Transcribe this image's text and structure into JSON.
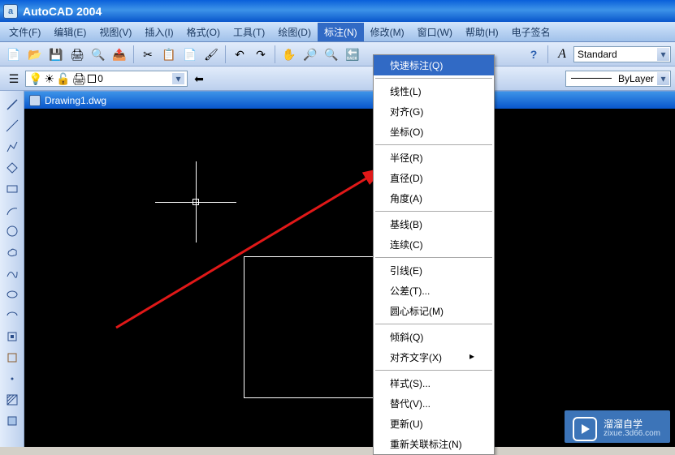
{
  "app": {
    "title": "AutoCAD 2004"
  },
  "menu": {
    "file": "文件(F)",
    "edit": "编辑(E)",
    "view": "视图(V)",
    "insert": "插入(I)",
    "format": "格式(O)",
    "tools": "工具(T)",
    "draw": "绘图(D)",
    "dimension": "标注(N)",
    "modify": "修改(M)",
    "window": "窗口(W)",
    "help": "帮助(H)",
    "esign": "电子签名"
  },
  "toolbar": {
    "layer_value": "0",
    "style_value": "Standard",
    "lineweight": "ByLayer"
  },
  "document": {
    "title": "Drawing1.dwg"
  },
  "dim_menu": {
    "quick": "快速标注(Q)",
    "linear": "线性(L)",
    "aligned": "对齐(G)",
    "ordinate": "坐标(O)",
    "radius": "半径(R)",
    "diameter": "直径(D)",
    "angular": "角度(A)",
    "baseline": "基线(B)",
    "continue": "连续(C)",
    "leader": "引线(E)",
    "tolerance": "公差(T)...",
    "center": "圆心标记(M)",
    "oblique": "倾斜(Q)",
    "align_text": "对齐文字(X)",
    "style": "样式(S)...",
    "override": "替代(V)...",
    "update": "更新(U)",
    "reassoc": "重新关联标注(N)"
  },
  "watermark": {
    "main": "溜溜自学",
    "sub": "zixue.3d66.com"
  }
}
